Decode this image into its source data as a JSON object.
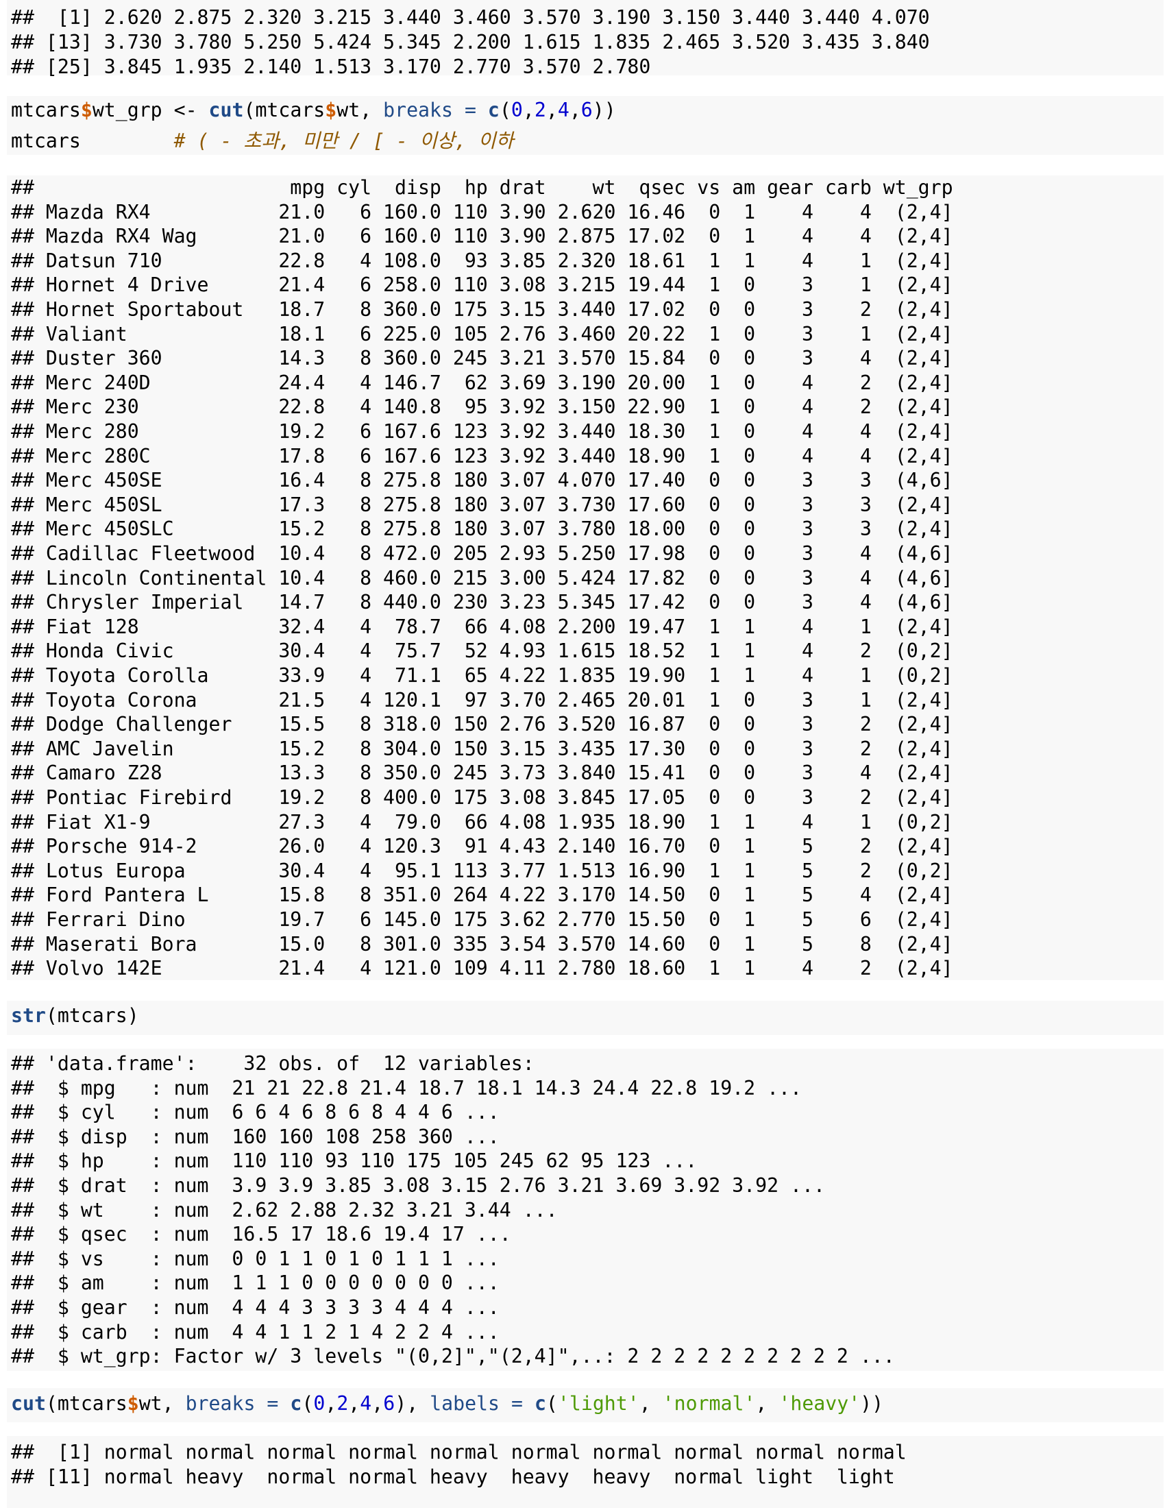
{
  "blocks": [
    {
      "type": "output",
      "lines": [
        "##  [1] 2.620 2.875 2.320 3.215 3.440 3.460 3.570 3.190 3.150 3.440 3.440 4.070",
        "## [13] 3.730 3.780 5.250 5.424 5.345 2.200 1.615 1.835 2.465 3.520 3.435 3.840",
        "## [25] 3.845 1.935 2.140 1.513 3.170 2.770 3.570 2.780"
      ]
    },
    {
      "type": "code",
      "lines": [
        [
          {
            "t": "mtcars",
            "c": ""
          },
          {
            "t": "$",
            "c": "op"
          },
          {
            "t": "wt_grp ",
            "c": ""
          },
          {
            "t": "<-",
            "c": "kr"
          },
          {
            "t": " ",
            "c": ""
          },
          {
            "t": "cut",
            "c": "fn"
          },
          {
            "t": "(mtcars",
            "c": ""
          },
          {
            "t": "$",
            "c": "op"
          },
          {
            "t": "wt, ",
            "c": ""
          },
          {
            "t": "breaks",
            "c": "arg"
          },
          {
            "t": " ",
            "c": ""
          },
          {
            "t": "=",
            "c": "arg"
          },
          {
            "t": " ",
            "c": ""
          },
          {
            "t": "c",
            "c": "fn"
          },
          {
            "t": "(",
            "c": ""
          },
          {
            "t": "0",
            "c": "num"
          },
          {
            "t": ",",
            "c": ""
          },
          {
            "t": "2",
            "c": "num"
          },
          {
            "t": ",",
            "c": ""
          },
          {
            "t": "4",
            "c": "num"
          },
          {
            "t": ",",
            "c": ""
          },
          {
            "t": "6",
            "c": "num"
          },
          {
            "t": "))",
            "c": ""
          }
        ],
        [
          {
            "t": "mtcars        ",
            "c": ""
          },
          {
            "t": "# ( - 초과, 미만 / [ - 이상, 이하",
            "c": "comment"
          }
        ]
      ]
    },
    {
      "type": "output",
      "lines": [
        "##                      mpg cyl  disp  hp drat    wt  qsec vs am gear carb wt_grp",
        "## Mazda RX4           21.0   6 160.0 110 3.90 2.620 16.46  0  1    4    4  (2,4]",
        "## Mazda RX4 Wag       21.0   6 160.0 110 3.90 2.875 17.02  0  1    4    4  (2,4]",
        "## Datsun 710          22.8   4 108.0  93 3.85 2.320 18.61  1  1    4    1  (2,4]",
        "## Hornet 4 Drive      21.4   6 258.0 110 3.08 3.215 19.44  1  0    3    1  (2,4]",
        "## Hornet Sportabout   18.7   8 360.0 175 3.15 3.440 17.02  0  0    3    2  (2,4]",
        "## Valiant             18.1   6 225.0 105 2.76 3.460 20.22  1  0    3    1  (2,4]",
        "## Duster 360          14.3   8 360.0 245 3.21 3.570 15.84  0  0    3    4  (2,4]",
        "## Merc 240D           24.4   4 146.7  62 3.69 3.190 20.00  1  0    4    2  (2,4]",
        "## Merc 230            22.8   4 140.8  95 3.92 3.150 22.90  1  0    4    2  (2,4]",
        "## Merc 280            19.2   6 167.6 123 3.92 3.440 18.30  1  0    4    4  (2,4]",
        "## Merc 280C           17.8   6 167.6 123 3.92 3.440 18.90  1  0    4    4  (2,4]",
        "## Merc 450SE          16.4   8 275.8 180 3.07 4.070 17.40  0  0    3    3  (4,6]",
        "## Merc 450SL          17.3   8 275.8 180 3.07 3.730 17.60  0  0    3    3  (2,4]",
        "## Merc 450SLC         15.2   8 275.8 180 3.07 3.780 18.00  0  0    3    3  (2,4]",
        "## Cadillac Fleetwood  10.4   8 472.0 205 2.93 5.250 17.98  0  0    3    4  (4,6]",
        "## Lincoln Continental 10.4   8 460.0 215 3.00 5.424 17.82  0  0    3    4  (4,6]",
        "## Chrysler Imperial   14.7   8 440.0 230 3.23 5.345 17.42  0  0    3    4  (4,6]",
        "## Fiat 128            32.4   4  78.7  66 4.08 2.200 19.47  1  1    4    1  (2,4]",
        "## Honda Civic         30.4   4  75.7  52 4.93 1.615 18.52  1  1    4    2  (0,2]",
        "## Toyota Corolla      33.9   4  71.1  65 4.22 1.835 19.90  1  1    4    1  (0,2]",
        "## Toyota Corona       21.5   4 120.1  97 3.70 2.465 20.01  1  0    3    1  (2,4]",
        "## Dodge Challenger    15.5   8 318.0 150 2.76 3.520 16.87  0  0    3    2  (2,4]",
        "## AMC Javelin         15.2   8 304.0 150 3.15 3.435 17.30  0  0    3    2  (2,4]",
        "## Camaro Z28          13.3   8 350.0 245 3.73 3.840 15.41  0  0    3    4  (2,4]",
        "## Pontiac Firebird    19.2   8 400.0 175 3.08 3.845 17.05  0  0    3    2  (2,4]",
        "## Fiat X1-9           27.3   4  79.0  66 4.08 1.935 18.90  1  1    4    1  (0,2]",
        "## Porsche 914-2       26.0   4 120.3  91 4.43 2.140 16.70  0  1    5    2  (2,4]",
        "## Lotus Europa        30.4   4  95.1 113 3.77 1.513 16.90  1  1    5    2  (0,2]",
        "## Ford Pantera L      15.8   8 351.0 264 4.22 3.170 14.50  0  1    5    4  (2,4]",
        "## Ferrari Dino        19.7   6 145.0 175 3.62 2.770 15.50  0  1    5    6  (2,4]",
        "## Maserati Bora       15.0   8 301.0 335 3.54 3.570 14.60  0  1    5    8  (2,4]",
        "## Volvo 142E          21.4   4 121.0 109 4.11 2.780 18.60  1  1    4    2  (2,4]"
      ]
    },
    {
      "type": "code",
      "lines": [
        [
          {
            "t": "str",
            "c": "fn"
          },
          {
            "t": "(mtcars)",
            "c": ""
          }
        ]
      ]
    },
    {
      "type": "output",
      "lines": [
        "## 'data.frame':    32 obs. of  12 variables:",
        "##  $ mpg   : num  21 21 22.8 21.4 18.7 18.1 14.3 24.4 22.8 19.2 ...",
        "##  $ cyl   : num  6 6 4 6 8 6 8 4 4 6 ...",
        "##  $ disp  : num  160 160 108 258 360 ...",
        "##  $ hp    : num  110 110 93 110 175 105 245 62 95 123 ...",
        "##  $ drat  : num  3.9 3.9 3.85 3.08 3.15 2.76 3.21 3.69 3.92 3.92 ...",
        "##  $ wt    : num  2.62 2.88 2.32 3.21 3.44 ...",
        "##  $ qsec  : num  16.5 17 18.6 19.4 17 ...",
        "##  $ vs    : num  0 0 1 1 0 1 0 1 1 1 ...",
        "##  $ am    : num  1 1 1 0 0 0 0 0 0 0 ...",
        "##  $ gear  : num  4 4 4 3 3 3 3 4 4 4 ...",
        "##  $ carb  : num  4 4 1 1 2 1 4 2 2 4 ...",
        "##  $ wt_grp: Factor w/ 3 levels \"(0,2]\",\"(2,4]\",..: 2 2 2 2 2 2 2 2 2 2 ..."
      ]
    },
    {
      "type": "code",
      "lines": [
        [
          {
            "t": "cut",
            "c": "fn"
          },
          {
            "t": "(mtcars",
            "c": ""
          },
          {
            "t": "$",
            "c": "op"
          },
          {
            "t": "wt, ",
            "c": ""
          },
          {
            "t": "breaks",
            "c": "arg"
          },
          {
            "t": " ",
            "c": ""
          },
          {
            "t": "=",
            "c": "arg"
          },
          {
            "t": " ",
            "c": ""
          },
          {
            "t": "c",
            "c": "fn"
          },
          {
            "t": "(",
            "c": ""
          },
          {
            "t": "0",
            "c": "num"
          },
          {
            "t": ",",
            "c": ""
          },
          {
            "t": "2",
            "c": "num"
          },
          {
            "t": ",",
            "c": ""
          },
          {
            "t": "4",
            "c": "num"
          },
          {
            "t": ",",
            "c": ""
          },
          {
            "t": "6",
            "c": "num"
          },
          {
            "t": "), ",
            "c": ""
          },
          {
            "t": "labels",
            "c": "arg"
          },
          {
            "t": " ",
            "c": ""
          },
          {
            "t": "=",
            "c": "arg"
          },
          {
            "t": " ",
            "c": ""
          },
          {
            "t": "c",
            "c": "fn"
          },
          {
            "t": "(",
            "c": ""
          },
          {
            "t": "'light'",
            "c": "str"
          },
          {
            "t": ", ",
            "c": ""
          },
          {
            "t": "'normal'",
            "c": "str"
          },
          {
            "t": ", ",
            "c": ""
          },
          {
            "t": "'heavy'",
            "c": "str"
          },
          {
            "t": "))",
            "c": ""
          }
        ]
      ]
    },
    {
      "type": "output",
      "lines": [
        "##  [1] normal normal normal normal normal normal normal normal normal normal",
        "## [11] normal heavy  normal normal heavy  heavy  heavy  normal light  light"
      ]
    }
  ]
}
